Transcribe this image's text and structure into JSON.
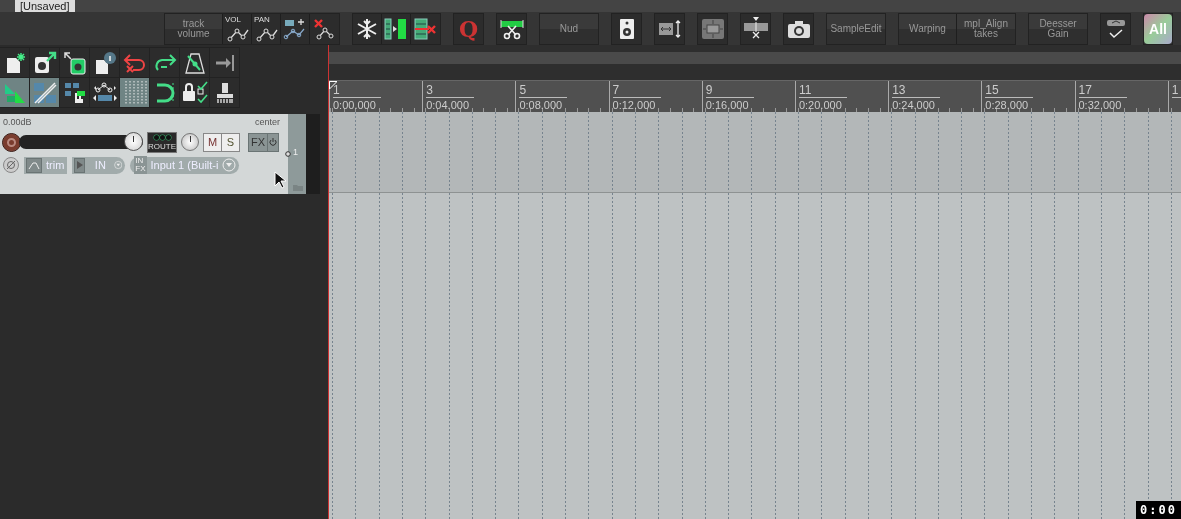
{
  "project_tab": "[Unsaved]",
  "toolbar": [
    [
      {
        "kind": "text",
        "label": "track\nvolume"
      },
      {
        "kind": "envelope",
        "label": "VOL"
      },
      {
        "kind": "envelope",
        "label": "PAN"
      },
      {
        "kind": "icon"
      },
      {
        "kind": "icon"
      }
    ],
    [
      {
        "kind": "icon"
      },
      {
        "kind": "icon"
      },
      {
        "kind": "icon"
      }
    ],
    [
      {
        "kind": "glyph",
        "label": "Q"
      }
    ],
    [
      {
        "kind": "icon"
      }
    ],
    [
      {
        "kind": "text",
        "label": "Nud"
      }
    ],
    [
      {
        "kind": "icon"
      }
    ],
    [
      {
        "kind": "icon"
      }
    ],
    [
      {
        "kind": "icon"
      }
    ],
    [
      {
        "kind": "icon"
      }
    ],
    [
      {
        "kind": "icon"
      }
    ],
    [
      {
        "kind": "text",
        "label": "SampleEdit"
      }
    ],
    [
      {
        "kind": "text",
        "label": "Warping"
      },
      {
        "kind": "text",
        "label": "mpl_Align\ntakes"
      }
    ],
    [
      {
        "kind": "text",
        "label": "Deesser\nGain"
      }
    ],
    [
      {
        "kind": "icon"
      }
    ],
    [
      {
        "kind": "all",
        "label": "All"
      }
    ]
  ],
  "left_toolbar": [
    [
      {
        "on": false
      },
      {
        "on": false
      },
      {
        "on": false
      },
      {
        "on": false
      },
      {
        "on": false
      },
      {
        "on": false
      },
      {
        "on": false
      },
      {
        "on": false
      }
    ],
    [
      {
        "on": true
      },
      {
        "on": true
      },
      {
        "on": false
      },
      {
        "on": false
      },
      {
        "on": true
      },
      {
        "on": false
      },
      {
        "on": false
      },
      {
        "on": false
      }
    ]
  ],
  "track": {
    "volume": "0.00dB",
    "pan": "center",
    "fader": {
      "level": 1
    },
    "route": "ROUTE",
    "mute": {
      "label": "M",
      "on": false
    },
    "solo": {
      "label": "S",
      "on": false
    },
    "fx": "FX",
    "trim": "trim",
    "monitor": "IN",
    "input_fx": [
      "IN",
      "FX"
    ],
    "input": "Input 1 (Built-i",
    "number": "1"
  },
  "ruler": [
    {
      "bar": "1",
      "time": "0:00.000"
    },
    {
      "bar": "3",
      "time": "0:04.000"
    },
    {
      "bar": "5",
      "time": "0:08.000"
    },
    {
      "bar": "7",
      "time": "0:12.000"
    },
    {
      "bar": "9",
      "time": "0:16.000"
    },
    {
      "bar": "11",
      "time": "0:20.000"
    },
    {
      "bar": "13",
      "time": "0:24.000"
    },
    {
      "bar": "15",
      "time": "0:28.000"
    },
    {
      "bar": "17",
      "time": "0:32.000"
    },
    {
      "bar": "1"
    }
  ],
  "timecode": "0:00"
}
